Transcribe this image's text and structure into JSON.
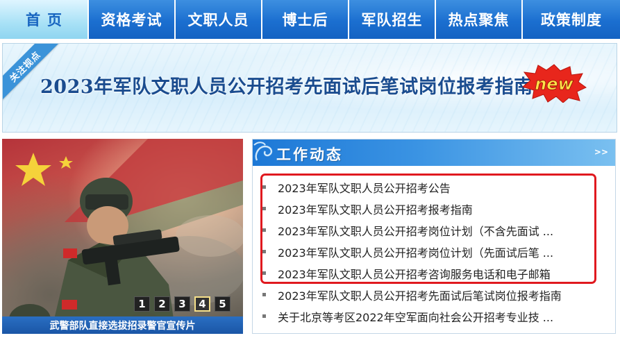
{
  "nav": {
    "items": [
      {
        "label": "首页",
        "active": true
      },
      {
        "label": "资格考试",
        "active": false
      },
      {
        "label": "文职人员",
        "active": false
      },
      {
        "label": "博士后",
        "active": false
      },
      {
        "label": "军队招生",
        "active": false
      },
      {
        "label": "热点聚焦",
        "active": false
      },
      {
        "label": "政策制度",
        "active": false
      }
    ]
  },
  "banner": {
    "ribbon": "关注视点",
    "title": "2023年军队文职人员公开招考先面试后笔试岗位报考指南",
    "badge": "new",
    "more": ">>"
  },
  "slider": {
    "pages": [
      "1",
      "2",
      "3",
      "4",
      "5"
    ],
    "active_page": "4",
    "caption": "武警部队直接选拔招录警官宣传片"
  },
  "news_panel": {
    "title": "工作动态",
    "more": ">>",
    "items": [
      "2023年军队文职人员公开招考公告",
      "2023年军队文职人员公开招考报考指南",
      "2023年军队文职人员公开招考岗位计划（不含先面试 ...",
      "2023年军队文职人员公开招考岗位计划（先面试后笔 ...",
      "2023年军队文职人员公开招考咨询服务电话和电子邮箱",
      "2023年军队文职人员公开招考先面试后笔试岗位报考指南",
      "关于北京等考区2022年空军面向社会公开招考专业技 ..."
    ]
  },
  "colors": {
    "nav_blue": "#1b6fd0",
    "nav_active": "#a8e1f6",
    "highlight_red": "#e0191f",
    "badge_red": "#e8261c",
    "badge_yellow": "#ffe14a"
  }
}
